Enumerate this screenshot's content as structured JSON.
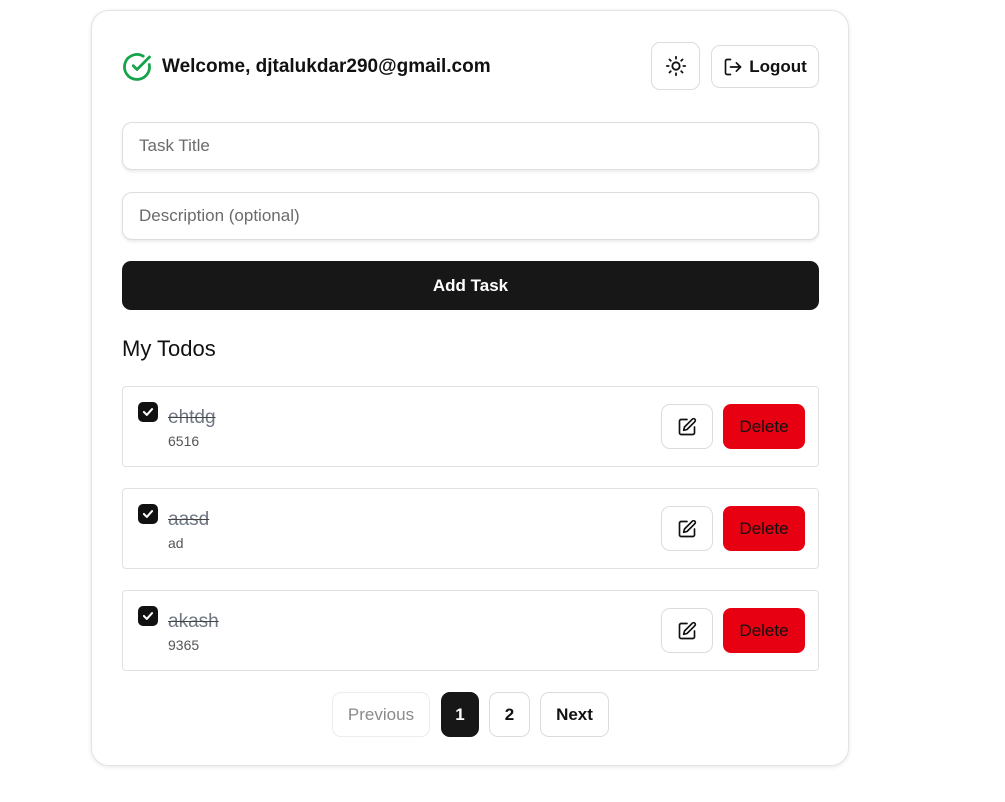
{
  "header": {
    "welcome_text": "Welcome, djtalukdar290@gmail.com",
    "status_icon": "check-circle-icon",
    "theme_icon": "sun-icon",
    "logout_label": "Logout",
    "logout_icon": "logout-icon"
  },
  "form": {
    "title_placeholder": "Task Title",
    "title_value": "",
    "description_placeholder": "Description (optional)",
    "description_value": "",
    "add_label": "Add Task"
  },
  "todos": {
    "heading": "My Todos",
    "items": [
      {
        "title": "ehtdg",
        "description": "6516",
        "completed": true,
        "delete_label": "Delete"
      },
      {
        "title": "aasd",
        "description": "ad",
        "completed": true,
        "delete_label": "Delete"
      },
      {
        "title": "akash",
        "description": "9365",
        "completed": true,
        "delete_label": "Delete"
      }
    ]
  },
  "pagination": {
    "previous_label": "Previous",
    "pages": [
      "1",
      "2"
    ],
    "current_page": "1",
    "next_label": "Next"
  },
  "colors": {
    "accent_green": "#16a34a",
    "primary_dark": "#171717",
    "danger_red": "#e60012"
  }
}
